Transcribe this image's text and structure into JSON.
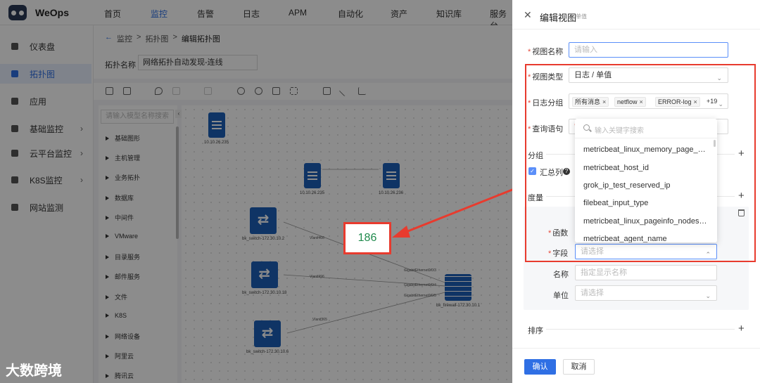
{
  "app": {
    "brand": "WeOps",
    "watermark": "大数跨境"
  },
  "topnav": {
    "items": [
      "首页",
      "监控",
      "告警",
      "日志",
      "APM",
      "自动化",
      "资产",
      "知识库",
      "服务台"
    ],
    "active": "监控"
  },
  "sidebar": {
    "items": [
      {
        "label": "仪表盘",
        "icon": "dashboard-icon"
      },
      {
        "label": "拓扑图",
        "icon": "topology-icon",
        "active": true
      },
      {
        "label": "应用",
        "icon": "apps-icon"
      },
      {
        "label": "基础监控",
        "icon": "monitor-icon",
        "expandable": true
      },
      {
        "label": "云平台监控",
        "icon": "cloud-icon",
        "expandable": true
      },
      {
        "label": "K8S监控",
        "icon": "k8s-icon",
        "expandable": true
      },
      {
        "label": "网站监测",
        "icon": "globe-icon"
      }
    ]
  },
  "breadcrumb": {
    "back": "←",
    "items": [
      "监控",
      "拓扑图",
      "编辑拓扑图"
    ],
    "sep": ">"
  },
  "topology": {
    "name_label": "拓扑名称",
    "name_value": "网络拓扑自动发现-连线"
  },
  "tree": {
    "search_placeholder": "请输入模型名称搜索",
    "items": [
      "基础图形",
      "主机管理",
      "业务拓扑",
      "数据库",
      "中间件",
      "VMware",
      "目录服务",
      "邮件服务",
      "文件",
      "K8S",
      "网络设备",
      "阿里云",
      "腾讯云"
    ]
  },
  "canvas": {
    "nodes": [
      "10.10.26.235",
      "10.10.26.235",
      "10.10.26.236",
      "bk_switch-172.30.10.2",
      "bk_switch-172.30.10.18",
      "bk_switch-172.30.10.6",
      "bk_firewall-172.30.10.1"
    ],
    "link_labels": [
      "Vlanif466",
      "Vlanif496",
      "Vlanif365",
      "GigabitEthernet0/0/3",
      "GigabitEthernet0/0/4",
      "GigabitEthernet0/0/5"
    ],
    "value": "186"
  },
  "drawer": {
    "title": "编辑视图",
    "subtitle": "单值",
    "view_name": {
      "label": "视图名称",
      "placeholder": "请输入"
    },
    "view_type": {
      "label": "视图类型",
      "value": "日志 / 单值"
    },
    "log_group": {
      "label": "日志分组",
      "tags": [
        "所有消息",
        "netflow",
        "ERROR-log"
      ],
      "more": "+19"
    },
    "query": {
      "label": "查询语句"
    },
    "group": {
      "label": "分组"
    },
    "summary": {
      "label": "汇总列",
      "checked": true
    },
    "measure": {
      "label": "度量"
    },
    "function": {
      "label": "函数"
    },
    "field": {
      "label": "字段",
      "placeholder": "请选择"
    },
    "name": {
      "label": "名称",
      "placeholder": "指定显示名称"
    },
    "unit": {
      "label": "单位",
      "placeholder": "请选择"
    },
    "sort": {
      "label": "排序"
    },
    "dropdown": {
      "search_placeholder": "输入关键字搜索",
      "options": [
        "metricbeat_linux_memory_page_st...",
        "metricbeat_host_id",
        "grok_ip_test_reserved_ip",
        "filebeat_input_type",
        "metricbeat_linux_pageinfo_nodes_...",
        "metricbeat_agent_name"
      ]
    },
    "confirm": "确认",
    "cancel": "取消"
  },
  "colors": {
    "accent": "#2f6fe4",
    "highlight": "#e83b2e",
    "node": "#1d5fb8",
    "value": "#1f8a4c"
  }
}
